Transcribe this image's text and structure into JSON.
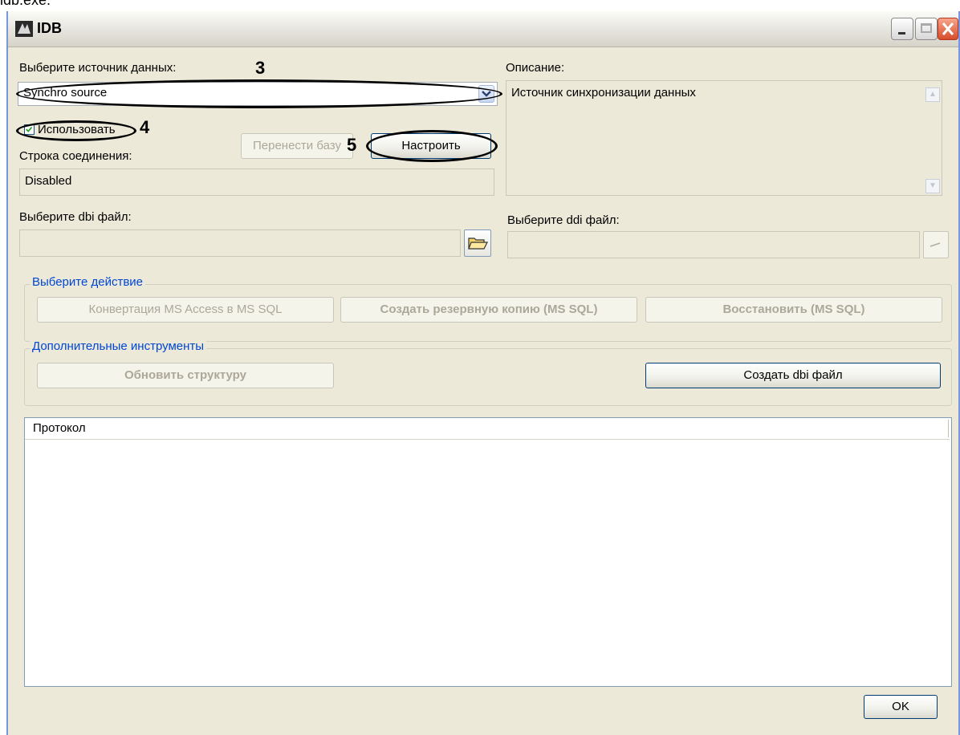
{
  "caption": "idb.exe.",
  "window": {
    "title": "IDB",
    "minimize_icon": "minimize-icon",
    "maximize_icon": "maximize-icon",
    "close_icon": "close-icon"
  },
  "datasource": {
    "label": "Выберите источник данных:",
    "selected": "Synchro source",
    "use_checkbox_label": "Использовать",
    "use_checked": true,
    "transfer_button": "Перенести базу",
    "configure_button": "Настроить",
    "connection_label": "Строка соединения:",
    "connection_value": "Disabled"
  },
  "description": {
    "label": "Описание:",
    "text": "Источник синхронизации данных"
  },
  "dbi": {
    "label": "Выберите dbi файл:",
    "value": "",
    "browse_icon": "folder-open-icon"
  },
  "ddi": {
    "label": "Выберите ddi файл:",
    "value": "",
    "browse_icon": "ddi-browse-icon"
  },
  "actions": {
    "group_title": "Выберите действие",
    "convert": "Конвертация MS Access в MS SQL",
    "backup": "Создать резервную копию  (MS SQL)",
    "restore": "Восстановить (MS SQL)"
  },
  "tools": {
    "group_title": "Дополнительные инструменты",
    "update_structure": "Обновить структуру",
    "create_dbi": "Создать dbi файл"
  },
  "protocol": {
    "header": "Протокол"
  },
  "footer": {
    "ok": "OK"
  },
  "annotations": {
    "n3": "3",
    "n4": "4",
    "n5": "5"
  }
}
